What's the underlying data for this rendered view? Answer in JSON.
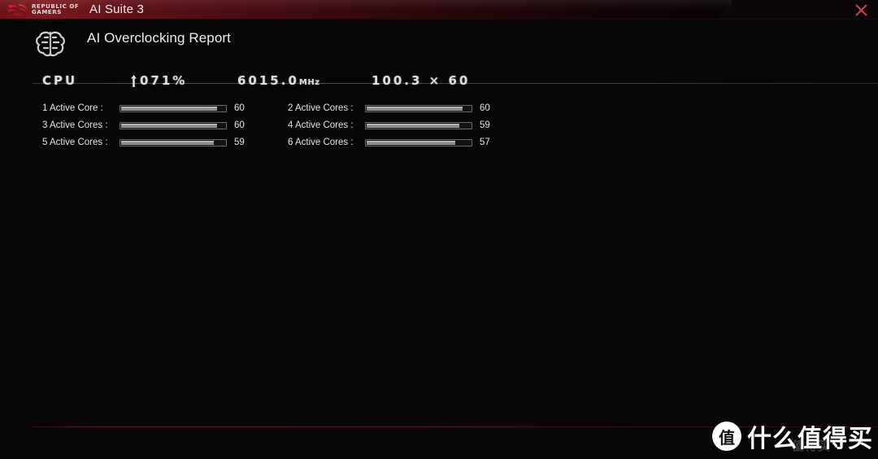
{
  "titlebar": {
    "brand_line1": "REPUBLIC OF",
    "brand_line2": "GAMERS",
    "app_title": "AI Suite 3",
    "close_label": "✕",
    "accent_color": "#7d1a20"
  },
  "header": {
    "page_title": "AI Overclocking Report",
    "icon": "ai-brain-icon"
  },
  "summary": {
    "cpu_label": "CPU",
    "load_arrow": "↑",
    "load_value": "071%",
    "frequency_value": "6015.0",
    "frequency_unit": "MHz",
    "ratio": "100.3 × 60"
  },
  "core_table": {
    "left": [
      {
        "label": "1 Active Core :",
        "value": "60",
        "percent": 92
      },
      {
        "label": "3 Active Cores :",
        "value": "60",
        "percent": 92
      },
      {
        "label": "5 Active Cores :",
        "value": "59",
        "percent": 89
      }
    ],
    "right": [
      {
        "label": "2 Active Cores :",
        "value": "60",
        "percent": 92
      },
      {
        "label": "4 Active Cores :",
        "value": "59",
        "percent": 89
      },
      {
        "label": "6 Active Cores :",
        "value": "57",
        "percent": 85
      }
    ]
  },
  "watermark": {
    "badge": "值",
    "text": "什么值得买",
    "ghost": "值得买"
  }
}
